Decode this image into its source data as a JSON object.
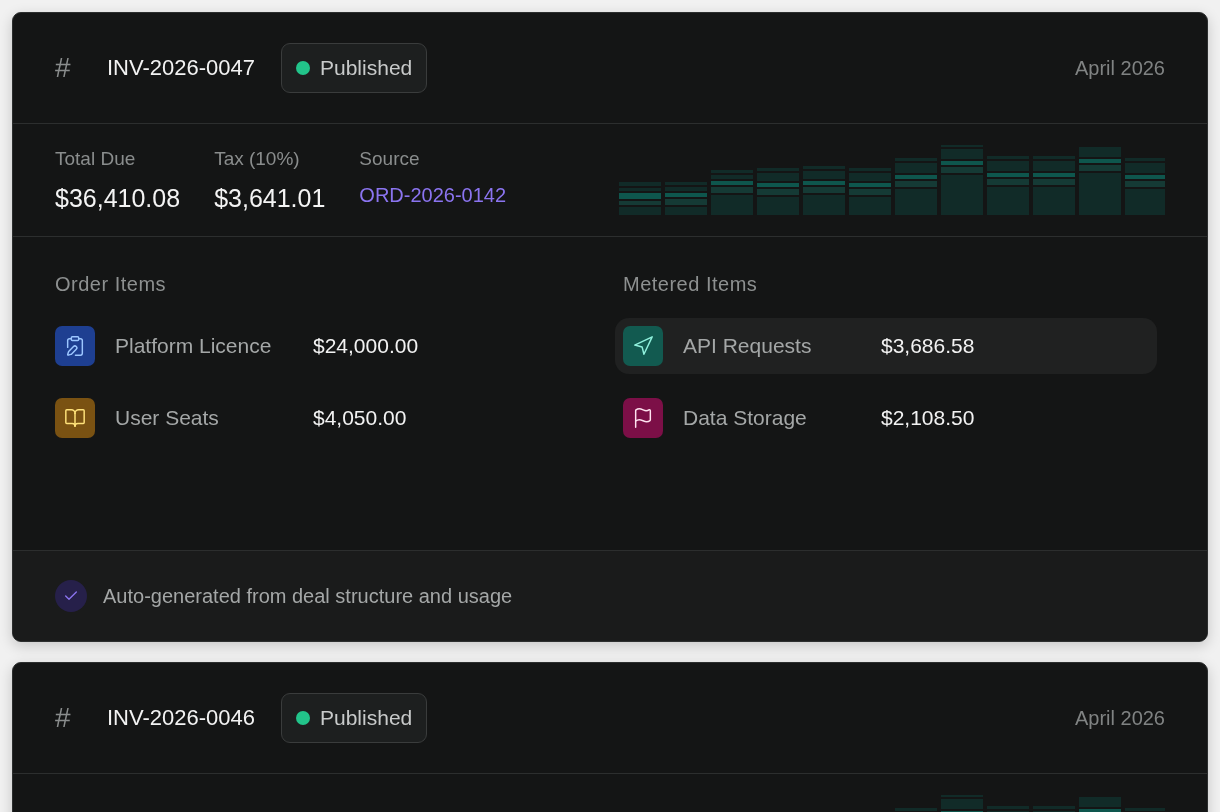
{
  "invoices": [
    {
      "number_icon": "#",
      "number": "INV-2026-0047",
      "status": {
        "label": "Published",
        "color": "#22c48a"
      },
      "date": "April 2026",
      "stats": [
        {
          "kind": "amount",
          "label": "Total Due",
          "value": "$36,410.08"
        },
        {
          "kind": "amount",
          "label": "Tax (10%)",
          "value": "$3,641.01"
        },
        {
          "kind": "link",
          "label": "Source",
          "value": "ORD-2026-0142"
        }
      ],
      "sections": [
        {
          "title": "Order Items",
          "items": [
            {
              "name": "Platform Licence",
              "amount": "$24,000.00",
              "kind": "clipboard",
              "color": "#1e3f91",
              "selected": false
            },
            {
              "name": "User Seats",
              "amount": "$4,050.00",
              "kind": "book",
              "color": "#7a5212",
              "selected": false
            }
          ]
        },
        {
          "title": "Metered Items",
          "items": [
            {
              "name": "API Requests",
              "amount": "$3,686.58",
              "kind": "navigation",
              "color": "#125a50",
              "selected": true
            },
            {
              "name": "Data Storage",
              "amount": "$2,108.50",
              "kind": "flag",
              "color": "#7c0f47",
              "selected": false
            }
          ]
        }
      ],
      "footer": {
        "text": "Auto-generated from deal structure and usage",
        "checked": true
      }
    },
    {
      "number_icon": "#",
      "number": "INV-2026-0046",
      "status": {
        "label": "Published",
        "color": "#22c48a"
      },
      "date": "April 2026"
    }
  ]
}
